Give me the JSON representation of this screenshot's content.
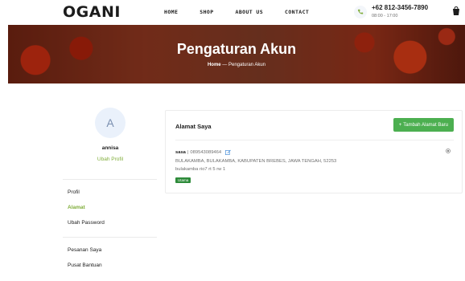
{
  "header": {
    "logo": "OGANI",
    "nav": [
      "HOME",
      "SHOP",
      "ABOUT US",
      "CONTACT"
    ],
    "phone": "+62 812-3456-7890",
    "hours": "08:00 - 17:00"
  },
  "hero": {
    "title": "Pengaturan Akun",
    "crumb_home": "Home",
    "crumb_sep": " — ",
    "crumb_current": "Pengaturan Akun"
  },
  "sidebar": {
    "avatar_letter": "A",
    "user_name": "annisa",
    "edit_profile": "Ubah Profil",
    "items": [
      {
        "label": "Profil",
        "active": false
      },
      {
        "label": "Alamat",
        "active": true
      },
      {
        "label": "Ubah Password",
        "active": false
      },
      {
        "label": "Pesanan Saya",
        "active": false
      },
      {
        "label": "Pusat Bantuan",
        "active": false
      }
    ]
  },
  "main": {
    "title": "Alamat Saya",
    "add_button": "Tambah Alamat Baru",
    "address": {
      "name": "sasa",
      "phone": "089543089464",
      "region": "BULAKAMBA, BULAKAMBA, KABUPATEN BREBES, JAWA TENGAH, 52253",
      "detail": "bulakamba rio7 rt 5 rw 1",
      "badge": "Utama"
    }
  },
  "colors": {
    "accent": "#7fad39",
    "button": "#4caf50",
    "badge": "#2e8b3a"
  }
}
